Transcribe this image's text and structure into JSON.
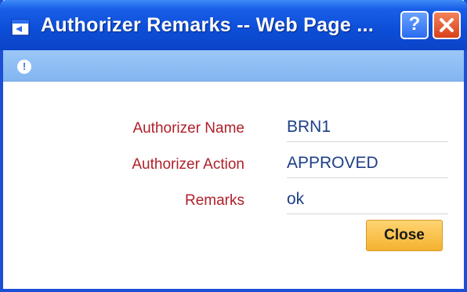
{
  "window": {
    "title": "Authorizer Remarks -- Web Page ...",
    "help_label": "?"
  },
  "infobar": {
    "icon_label": "!"
  },
  "form": {
    "fields": [
      {
        "label": "Authorizer Name",
        "value": "BRN1"
      },
      {
        "label": "Authorizer Action",
        "value": "APPROVED"
      },
      {
        "label": "Remarks",
        "value": "ok"
      }
    ],
    "close_label": "Close"
  },
  "colors": {
    "titlebar": "#0d4fd8",
    "label": "#b0202a",
    "value": "#1d3f86",
    "close_button": "#f3b230"
  }
}
